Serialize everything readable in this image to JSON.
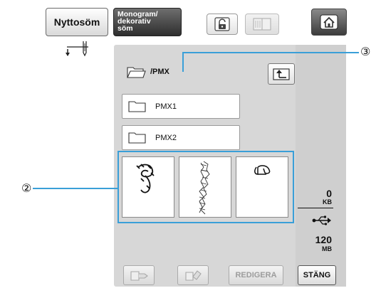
{
  "top_bar": {
    "utility_tab": "Nyttosöm",
    "monogram_tab_lines": [
      "Monogram/",
      "dekorativ",
      "söm"
    ],
    "lock_icon": "lock-icon",
    "book_icon": "book-icon",
    "home_icon": "home-icon"
  },
  "left": {
    "needle_icon": "needle-position-icon"
  },
  "browser": {
    "current_path": "/PMX",
    "folders": [
      {
        "label": "PMX1"
      },
      {
        "label": "PMX2"
      }
    ],
    "patterns": [
      {
        "name": "pattern-1"
      },
      {
        "name": "pattern-2"
      },
      {
        "name": "pattern-3"
      }
    ]
  },
  "memory": {
    "used_value": "0",
    "used_unit": "KB",
    "usb_icon": "usb-icon",
    "total_value": "120",
    "total_unit": "MB"
  },
  "bottom_bar": {
    "edit_label": "REDIGERA",
    "close_label": "STÄNG"
  },
  "callouts": {
    "label_2": "②",
    "label_3": "③"
  },
  "colors": {
    "panel_bg": "#d7d7d7",
    "highlight": "#3a9fd8"
  }
}
